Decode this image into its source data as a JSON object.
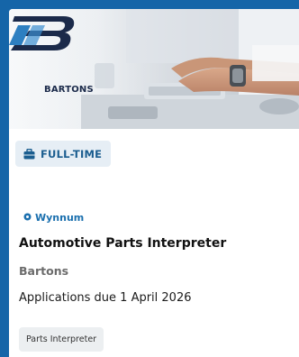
{
  "job": {
    "company_logo_text": "BARTONS",
    "employment_type": "FULL-TIME",
    "location": "Wynnum",
    "title": "Automotive Parts Interpreter",
    "company": "Bartons",
    "applications_due": "Applications due 1 April 2026",
    "tags": [
      "Parts Interpreter"
    ]
  },
  "icons": {
    "employment_type": "briefcase-icon",
    "location": "location-pin-icon"
  },
  "colors": {
    "page_background": "#1565a8",
    "badge_text": "#1a5d8f",
    "badge_background": "#e6eef5",
    "location_text": "#1a6fae",
    "tag_background": "#eceff1"
  }
}
